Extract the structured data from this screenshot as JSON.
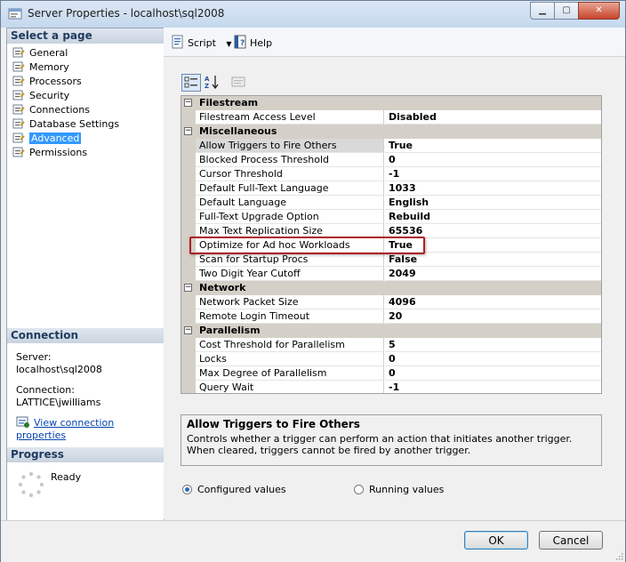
{
  "window": {
    "title": "Server Properties - localhost\\sql2008",
    "min": "▁",
    "max": "▢",
    "close": "✕"
  },
  "left": {
    "select_page_header": "Select a page",
    "pages": [
      {
        "label": "General"
      },
      {
        "label": "Memory"
      },
      {
        "label": "Processors"
      },
      {
        "label": "Security"
      },
      {
        "label": "Connections"
      },
      {
        "label": "Database Settings"
      },
      {
        "label": "Advanced"
      },
      {
        "label": "Permissions"
      }
    ],
    "selected_page": "Advanced",
    "connection_header": "Connection",
    "server_label": "Server:",
    "server_value": "localhost\\sql2008",
    "connection_label": "Connection:",
    "connection_value": "LATTICE\\jwilliams",
    "view_link": "View connection properties",
    "progress_header": "Progress",
    "progress_status": "Ready"
  },
  "toolbar": {
    "script_label": "Script",
    "help_label": "Help"
  },
  "grid": {
    "categories": [
      {
        "label": "Filestream",
        "rows": [
          {
            "name": "Filestream Access Level",
            "value": "Disabled"
          }
        ]
      },
      {
        "label": "Miscellaneous",
        "rows": [
          {
            "name": "Allow Triggers to Fire Others",
            "value": "True"
          },
          {
            "name": "Blocked Process Threshold",
            "value": "0"
          },
          {
            "name": "Cursor Threshold",
            "value": "-1"
          },
          {
            "name": "Default Full-Text Language",
            "value": "1033"
          },
          {
            "name": "Default Language",
            "value": "English"
          },
          {
            "name": "Full-Text Upgrade Option",
            "value": "Rebuild"
          },
          {
            "name": "Max Text Replication Size",
            "value": "65536"
          },
          {
            "name": "Optimize for Ad hoc Workloads",
            "value": "True"
          },
          {
            "name": "Scan for Startup Procs",
            "value": "False"
          },
          {
            "name": "Two Digit Year Cutoff",
            "value": "2049"
          }
        ]
      },
      {
        "label": "Network",
        "rows": [
          {
            "name": "Network Packet Size",
            "value": "4096"
          },
          {
            "name": "Remote Login Timeout",
            "value": "20"
          }
        ]
      },
      {
        "label": "Parallelism",
        "rows": [
          {
            "name": "Cost Threshold for Parallelism",
            "value": "5"
          },
          {
            "name": "Locks",
            "value": "0"
          },
          {
            "name": "Max Degree of Parallelism",
            "value": "0"
          },
          {
            "name": "Query Wait",
            "value": "-1"
          }
        ]
      }
    ]
  },
  "description": {
    "title": "Allow Triggers to Fire Others",
    "text": "Controls whether a trigger can perform an action that initiates another trigger. When cleared, triggers cannot be fired by another trigger."
  },
  "radios": {
    "configured": "Configured values",
    "running": "Running values"
  },
  "buttons": {
    "ok": "OK",
    "cancel": "Cancel"
  },
  "colors": {
    "selection": "#3399ff",
    "highlight_border": "#b01e24",
    "category_bg": "#d4d0c8"
  }
}
